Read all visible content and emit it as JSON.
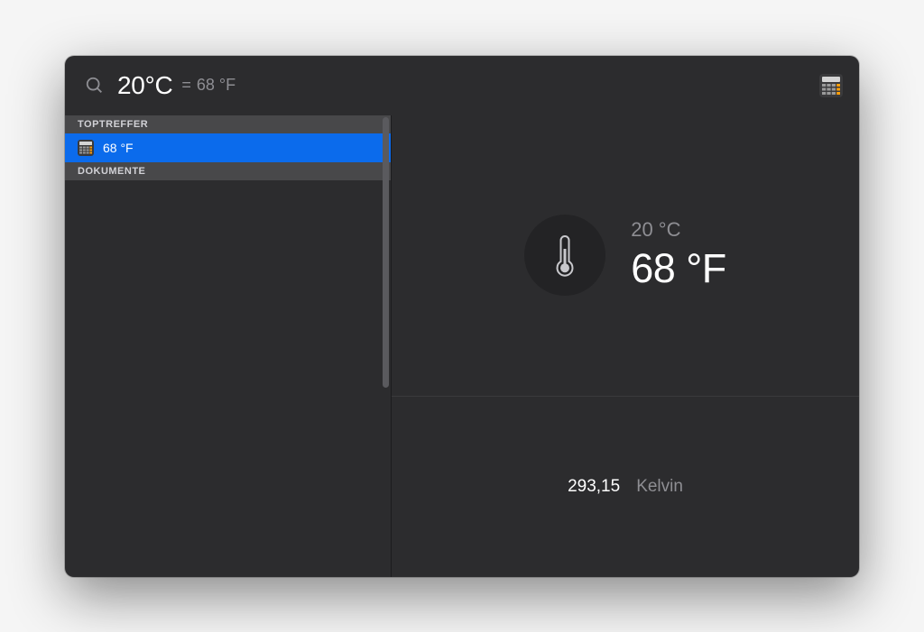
{
  "search": {
    "query": "20°C",
    "equals_symbol": "=",
    "inline_result": "68 °F"
  },
  "sidebar": {
    "sections": [
      {
        "header": "TOPTREFFER",
        "items": [
          {
            "label": "68 °F",
            "selected": true
          }
        ]
      },
      {
        "header": "DOKUMENTE",
        "items": []
      }
    ]
  },
  "preview": {
    "input_temperature": "20 °C",
    "output_temperature": "68 °F",
    "additional": {
      "value": "293,15",
      "unit": "Kelvin"
    }
  }
}
